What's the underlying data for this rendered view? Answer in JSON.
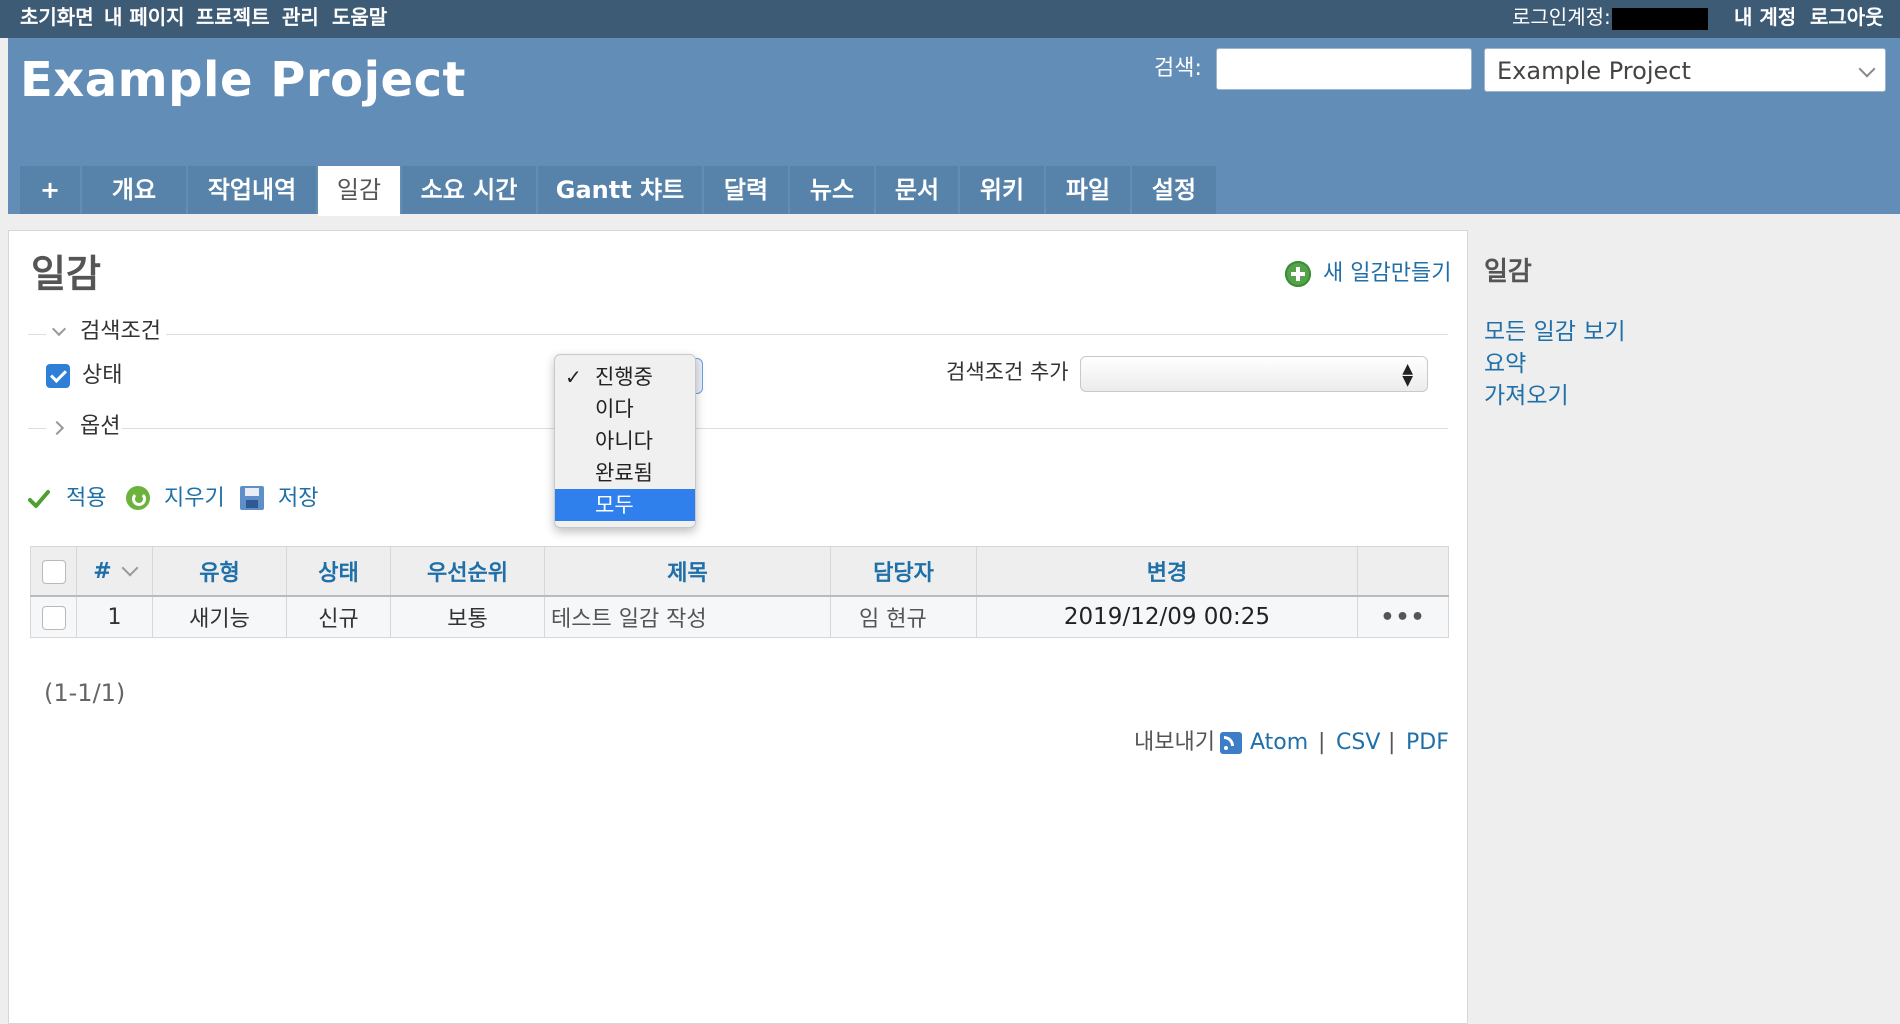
{
  "top_menu": {
    "left": [
      "초기화면",
      "내 페이지",
      "프로젝트",
      "관리",
      "도움말"
    ],
    "login_label": "로그인계정:",
    "right": [
      "내 계정",
      "로그아웃"
    ]
  },
  "header": {
    "project_title": "Example Project",
    "search_label": "검색:",
    "search_value": "",
    "project_select_value": "Example Project"
  },
  "tabs": [
    "+",
    "개요",
    "작업내역",
    "일감",
    "소요 시간",
    "Gantt 챠트",
    "달력",
    "뉴스",
    "문서",
    "위키",
    "파일",
    "설정"
  ],
  "selected_tab": "일감",
  "content": {
    "title": "일감",
    "new_issue_label": "새 일감만들기",
    "filters_legend": "검색조건",
    "status_filter_label": "상태",
    "status_filter_checked": true,
    "add_filter_label": "검색조건 추가",
    "options_legend": "옵션",
    "actions": {
      "apply": "적용",
      "clear": "지우기",
      "save": "저장"
    },
    "status_dropdown": {
      "options": [
        "진행중",
        "이다",
        "아니다",
        "완료됨",
        "모두"
      ],
      "checked": "진행중",
      "highlighted": "모두"
    },
    "table": {
      "headers": [
        "#",
        "유형",
        "상태",
        "우선순위",
        "제목",
        "담당자",
        "변경"
      ],
      "rows": [
        {
          "id": "1",
          "tracker": "새기능",
          "status": "신규",
          "priority": "보통",
          "subject": "테스트 일감 작성",
          "assignee": "임 현규",
          "updated": "2019/12/09 00:25",
          "menu": "•••"
        }
      ]
    },
    "pagination": "(1-1/1)",
    "export": {
      "label": "내보내기",
      "formats": [
        "Atom",
        "|",
        "CSV",
        "|",
        "PDF"
      ]
    }
  },
  "sidebar": {
    "title": "일감",
    "links": [
      "모든 일감 보기",
      "요약",
      "가져오기"
    ]
  },
  "colors": {
    "top_menu_bg": "#3e5b76",
    "header_bg": "#628db6",
    "tab_bg": "#5782a9",
    "link": "#1f6fa8",
    "highlight": "#2f80ed"
  }
}
